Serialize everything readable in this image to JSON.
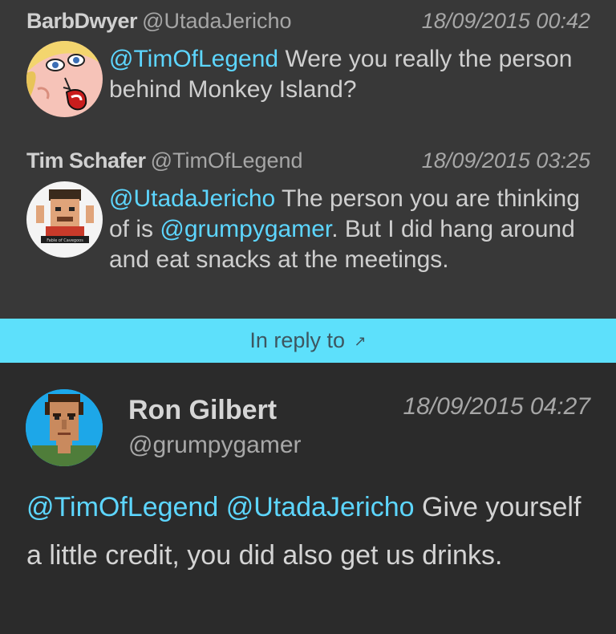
{
  "thread": [
    {
      "name": "BarbDwyer",
      "handle": "@UtadaJericho",
      "time": "18/09/2015 00:42",
      "mention": "@TimOfLegend",
      "text": " Were you really the person behind Monkey Island?",
      "avatar": "cartoon-face-avatar"
    },
    {
      "name": "Tim Schafer",
      "handle": "@TimOfLegend",
      "time": "18/09/2015 03:25",
      "mention": "@UtadaJericho",
      "text_a": " The person you are thinking of is ",
      "mention_b": "@grumpygamer",
      "text_b": ". But I did hang around and eat snacks at the meetings.",
      "avatar": "pixel-art-avatar",
      "avatar_caption": "Fable of Cavegoos"
    }
  ],
  "reply_bar": {
    "label": "In reply to",
    "icon": "arrow-up-right-icon",
    "arrow": "↗"
  },
  "main": {
    "name": "Ron Gilbert",
    "handle": "@grumpygamer",
    "time": "18/09/2015 04:27",
    "mention_a": "@TimOfLegend",
    "mention_b": "@UtadaJericho",
    "text": " Give yourself a little credit, you did also get us drinks.",
    "avatar": "pixel-portrait-avatar"
  },
  "colors": {
    "background": "#2e2e2e",
    "thread_background": "#383838",
    "mention": "#5dd6ff",
    "reply_bar": "#5de0fb",
    "avatar_blue": "#1da7e8"
  }
}
